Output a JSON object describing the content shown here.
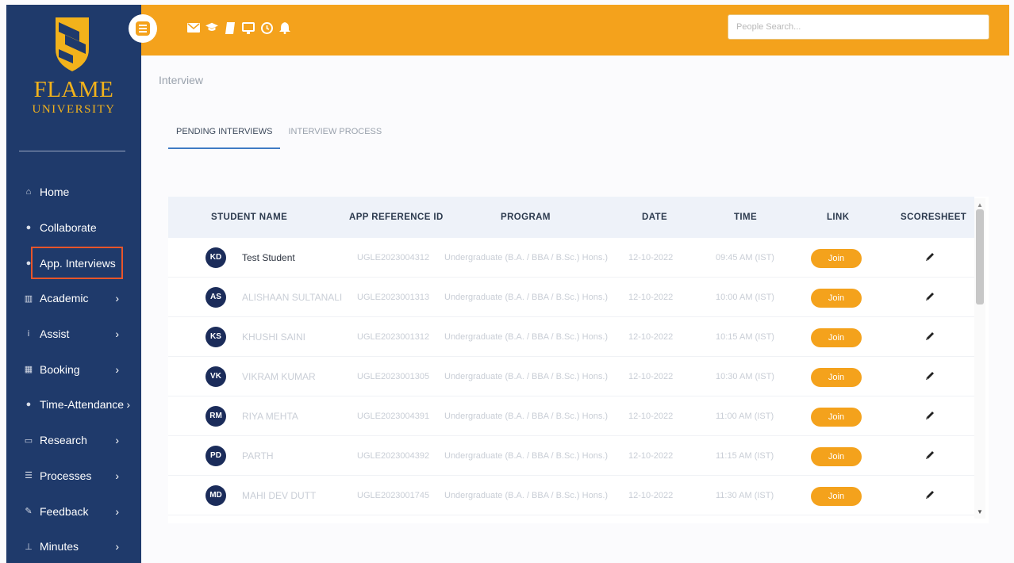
{
  "brand": {
    "name": "FLAME",
    "subtitle": "UNIVERSITY",
    "primary_color": "#1f3a6b",
    "accent_color": "#f4a21c"
  },
  "sidebar": {
    "items": [
      {
        "label": "Home",
        "icon": "home-icon",
        "glyph": "⌂",
        "chevron": ""
      },
      {
        "label": "Collaborate",
        "icon": "chat-icon",
        "glyph": "●",
        "chevron": ""
      },
      {
        "label": "App. Interviews",
        "icon": "chat-icon",
        "glyph": "●",
        "chevron": "",
        "active": true
      },
      {
        "label": "Academic",
        "icon": "institution-icon",
        "glyph": "▥",
        "chevron": "›"
      },
      {
        "label": "Assist",
        "icon": "info-icon",
        "glyph": "i",
        "chevron": "›"
      },
      {
        "label": "Booking",
        "icon": "calendar-icon",
        "glyph": "▦",
        "chevron": "›"
      },
      {
        "label": "Time-Attendance",
        "icon": "user-icon",
        "glyph": "●",
        "chevron": "›"
      },
      {
        "label": "Research",
        "icon": "clipboard-icon",
        "glyph": "▭",
        "chevron": "›"
      },
      {
        "label": "Processes",
        "icon": "list-icon",
        "glyph": "☰",
        "chevron": "›"
      },
      {
        "label": "Feedback",
        "icon": "edit-icon",
        "glyph": "✎",
        "chevron": "›"
      },
      {
        "label": "Minutes",
        "icon": "sitemap-icon",
        "glyph": "⊥",
        "chevron": "›"
      }
    ]
  },
  "topbar": {
    "icons": [
      "mail-icon",
      "graduation-cap-icon",
      "book-icon",
      "monitor-icon",
      "clock-icon",
      "bell-icon"
    ],
    "search_placeholder": "People Search..."
  },
  "page": {
    "breadcrumb": "Interview",
    "tabs": [
      {
        "label": "PENDING INTERVIEWS",
        "active": true
      },
      {
        "label": "INTERVIEW PROCESS",
        "active": false
      }
    ]
  },
  "table": {
    "columns": [
      "STUDENT NAME",
      "APP REFERENCE ID",
      "PROGRAM",
      "DATE",
      "TIME",
      "LINK",
      "SCORESHEET"
    ],
    "rows": [
      {
        "initials": "KD",
        "name": "Test Student",
        "ref": "UGLE2023004312",
        "program": "Undergraduate (B.A. / BBA / B.Sc.) Hons.)",
        "date": "12-10-2022",
        "time": "09:45 AM (IST)",
        "link": "Join"
      },
      {
        "initials": "AS",
        "name": "ALISHAAN SULTANALI",
        "ref": "UGLE2023001313",
        "program": "Undergraduate (B.A. / BBA / B.Sc.) Hons.)",
        "date": "12-10-2022",
        "time": "10:00 AM (IST)",
        "link": "Join"
      },
      {
        "initials": "KS",
        "name": "KHUSHI SAINI",
        "ref": "UGLE2023001312",
        "program": "Undergraduate (B.A. / BBA / B.Sc.) Hons.)",
        "date": "12-10-2022",
        "time": "10:15 AM (IST)",
        "link": "Join"
      },
      {
        "initials": "VK",
        "name": "VIKRAM KUMAR",
        "ref": "UGLE2023001305",
        "program": "Undergraduate (B.A. / BBA / B.Sc.) Hons.)",
        "date": "12-10-2022",
        "time": "10:30 AM (IST)",
        "link": "Join"
      },
      {
        "initials": "RM",
        "name": "RIYA MEHTA",
        "ref": "UGLE2023004391",
        "program": "Undergraduate (B.A. / BBA / B.Sc.) Hons.)",
        "date": "12-10-2022",
        "time": "11:00 AM (IST)",
        "link": "Join"
      },
      {
        "initials": "PD",
        "name": "PARTH",
        "ref": "UGLE2023004392",
        "program": "Undergraduate (B.A. / BBA / B.Sc.) Hons.)",
        "date": "12-10-2022",
        "time": "11:15 AM (IST)",
        "link": "Join"
      },
      {
        "initials": "MD",
        "name": "MAHI DEV DUTT",
        "ref": "UGLE2023001745",
        "program": "Undergraduate (B.A. / BBA / B.Sc.) Hons.)",
        "date": "12-10-2022",
        "time": "11:30 AM (IST)",
        "link": "Join"
      }
    ]
  }
}
